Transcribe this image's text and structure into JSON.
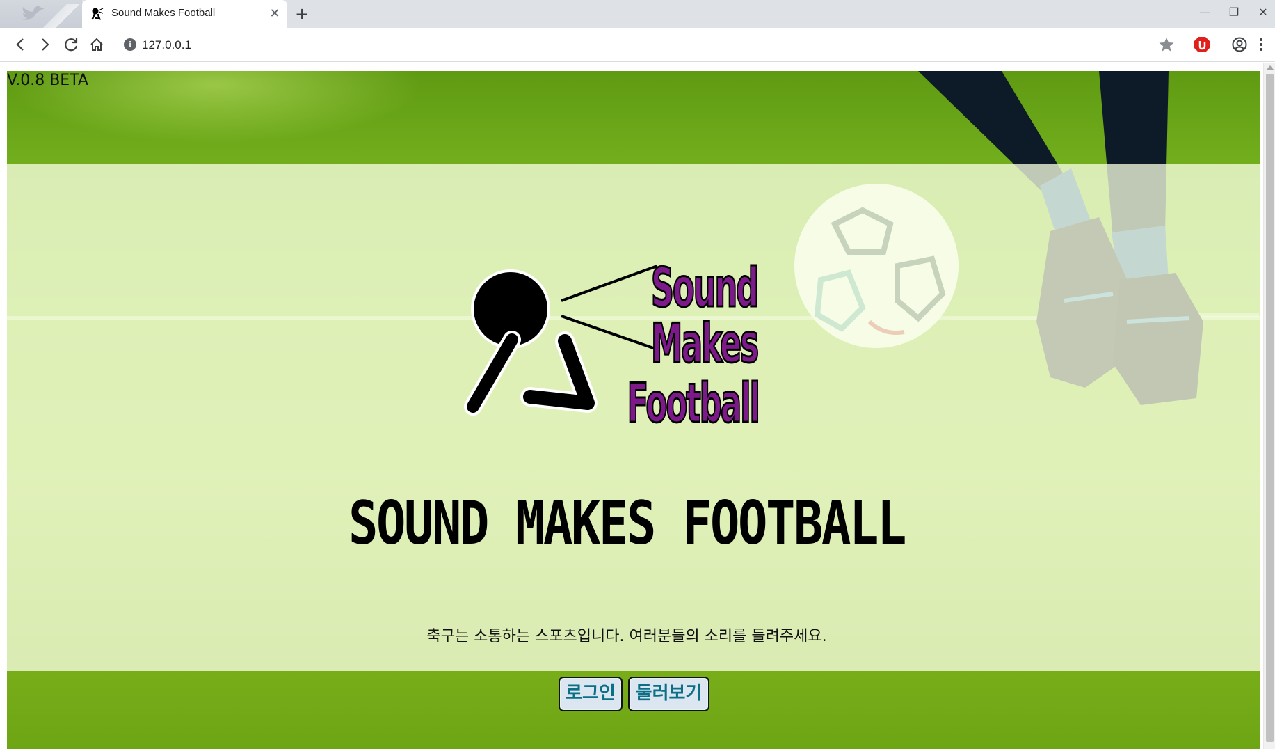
{
  "browser": {
    "tab_title": "Sound Makes Football",
    "tab_close": "✕",
    "new_tab": "+",
    "url": "127.0.0.1",
    "info_icon": "i",
    "window_minimize": "—",
    "window_restore": "❐",
    "window_close": "✕",
    "icons": [
      "back-icon",
      "forward-icon",
      "reload-icon",
      "home-icon",
      "info-icon",
      "star-icon",
      "adblock-icon",
      "account-icon",
      "menu-icon"
    ]
  },
  "page": {
    "version": "V.0.8 BETA",
    "logo_text": [
      "Sound",
      "Makes",
      "Football"
    ],
    "headline": "SOUND MAKES FOOTBALL",
    "tagline": "축구는 소통하는 스포츠입니다. 여러분들의 소리를 들려주세요.",
    "login_button": "로그인",
    "browse_button": "둘러보기",
    "colors": {
      "logo_fill": "#7d1a8a",
      "logo_outline": "#000000",
      "button_bg": "#dbe6f1",
      "button_text": "#0b6f86",
      "panel_overlay": "rgba(248,255,228,0.76)",
      "grass": "#8cc12a"
    }
  }
}
